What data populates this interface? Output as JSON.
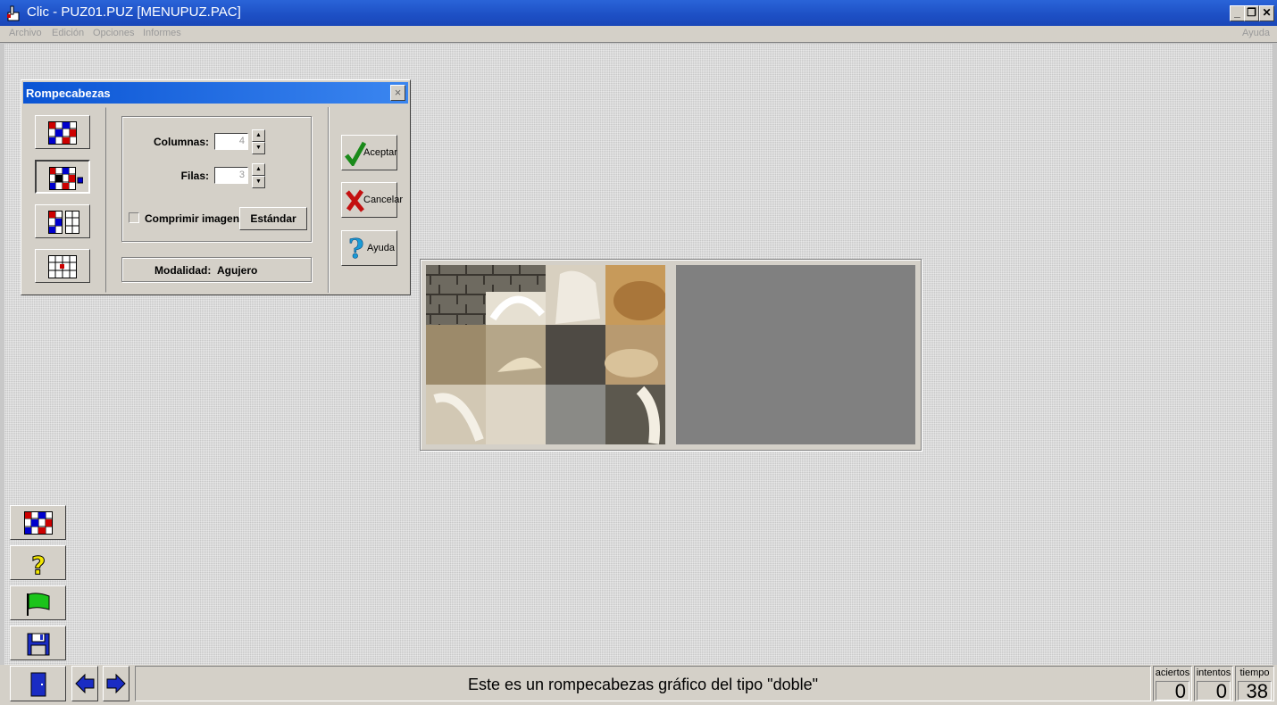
{
  "window": {
    "title": "Clic - PUZ01.PUZ [MENUPUZ.PAC]",
    "minimize": "_",
    "restore": "❐",
    "close": "✕"
  },
  "menu": {
    "items": [
      "Archivo",
      "Edición",
      "Opciones",
      "Informes"
    ],
    "help": "Ayuda"
  },
  "dialog": {
    "title": "Rompecabezas",
    "close_icon": "×",
    "columns_label": "Columnas:",
    "columns_value": "4",
    "rows_label": "Filas:",
    "rows_value": "3",
    "compress_label": "Comprimir imagen",
    "compress_checked": false,
    "standard_button": "Estándar",
    "mode_label": "Modalidad:",
    "mode_value": "Agujero",
    "accept": "Aceptar",
    "cancel": "Cancelar",
    "help": "Ayuda"
  },
  "status": {
    "message": "Este es un rompecabezas gráfico del tipo \"doble\"",
    "counters": [
      {
        "label": "aciertos",
        "value": "0"
      },
      {
        "label": "intentos",
        "value": "0"
      },
      {
        "label": "tiempo",
        "value": "38"
      }
    ]
  },
  "icons": {
    "app": "hand-pointer-icon",
    "tools": [
      "puzzle-grid-icon",
      "question-icon",
      "green-flag-icon",
      "floppy-disk-icon"
    ],
    "nav": [
      "exit-door-icon",
      "arrow-left-icon",
      "arrow-right-icon"
    ]
  },
  "colors": {
    "titlebar": "#1d4fc4",
    "dialog_title": "#0a54d4",
    "panel": "#d4d0c8",
    "target_area": "#808080"
  }
}
